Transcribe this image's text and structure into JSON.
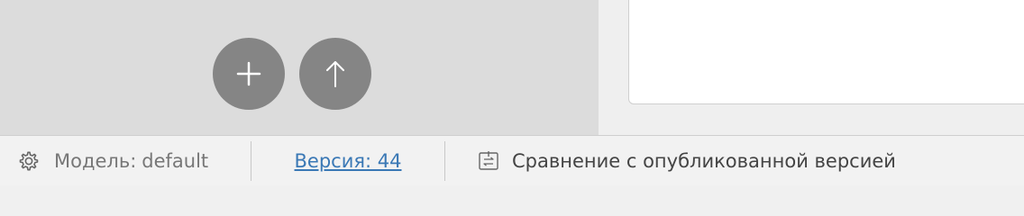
{
  "actions": {
    "add_icon": "plus-icon",
    "upload_icon": "arrow-up-icon"
  },
  "status_bar": {
    "model_label": "Модель:",
    "model_value": "default",
    "version_link": "Версия: 44",
    "compare_label": "Сравнение с опубликованной версией"
  },
  "colors": {
    "fab_background": "#858585",
    "link": "#3a78b5",
    "left_pane": "#dcdcdc"
  }
}
